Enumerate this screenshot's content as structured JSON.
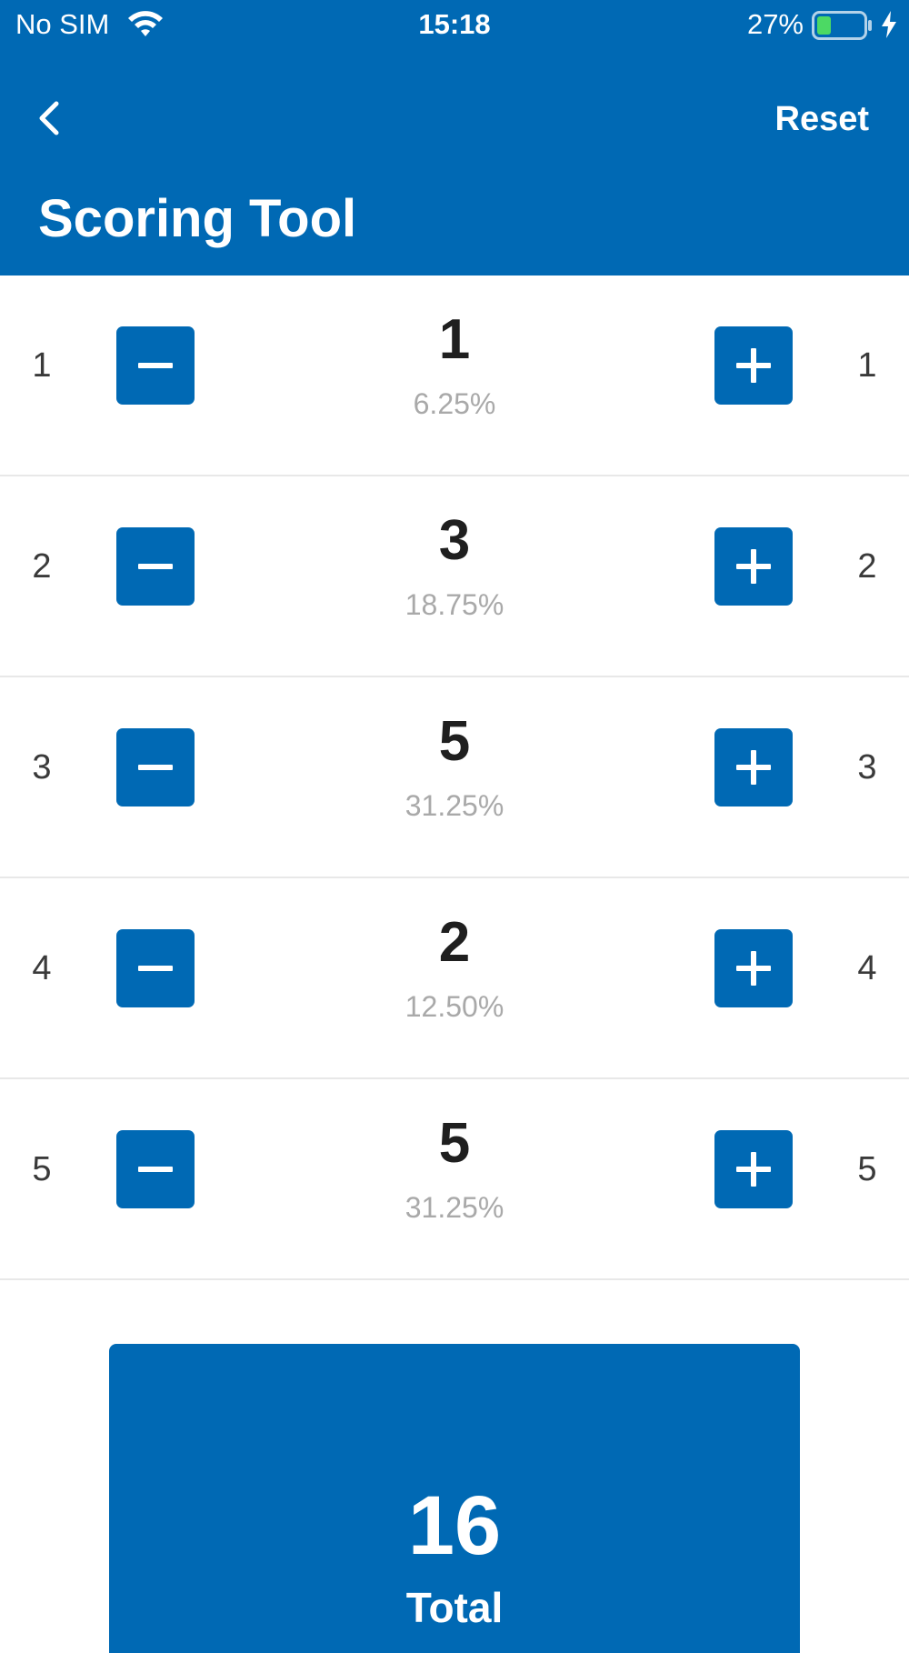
{
  "status_bar": {
    "carrier": "No SIM",
    "time": "15:18",
    "battery_percent": "27%",
    "icons": [
      "wifi-icon",
      "battery-icon",
      "charging-bolt-icon"
    ]
  },
  "nav": {
    "back_icon": "chevron-left-icon",
    "reset_label": "Reset",
    "title": "Scoring Tool"
  },
  "rows": [
    {
      "label_left": "1",
      "label_right": "1",
      "count": "1",
      "percent": "6.25%"
    },
    {
      "label_left": "2",
      "label_right": "2",
      "count": "3",
      "percent": "18.75%"
    },
    {
      "label_left": "3",
      "label_right": "3",
      "count": "5",
      "percent": "31.25%"
    },
    {
      "label_left": "4",
      "label_right": "4",
      "count": "2",
      "percent": "12.50%"
    },
    {
      "label_left": "5",
      "label_right": "5",
      "count": "5",
      "percent": "31.25%"
    }
  ],
  "total": {
    "value": "16",
    "label": "Total"
  },
  "colors": {
    "primary": "#0069b4",
    "background": "#ffffff",
    "percent_text": "#a9a9a9",
    "battery_fill": "#4cd964"
  }
}
